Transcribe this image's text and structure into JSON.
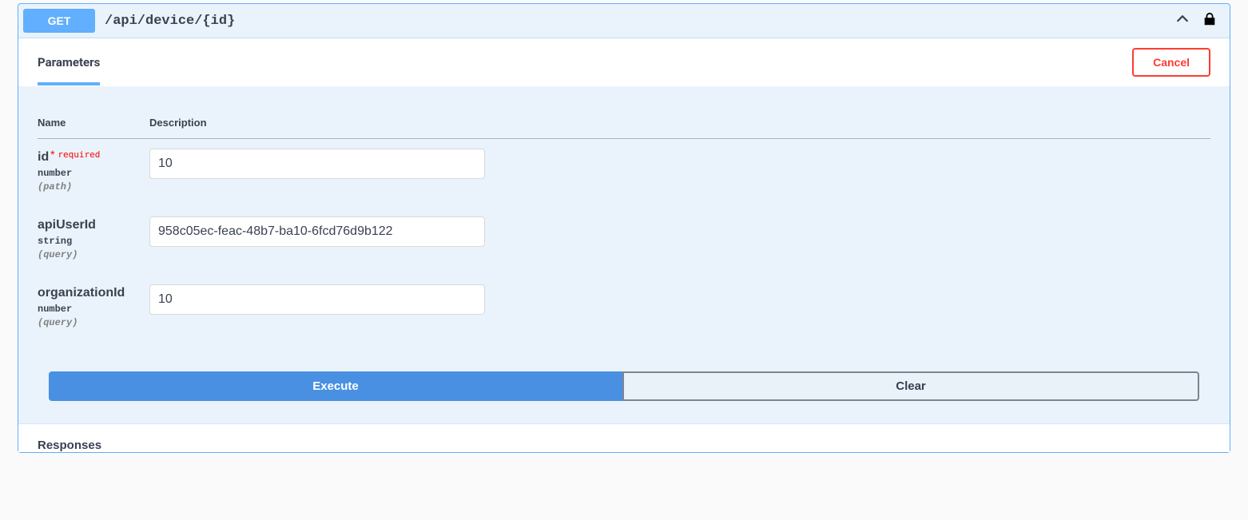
{
  "summary": {
    "method": "GET",
    "path": "/api/device/{id}"
  },
  "tabs": {
    "parameters": "Parameters"
  },
  "buttons": {
    "cancel": "Cancel",
    "execute": "Execute",
    "clear": "Clear"
  },
  "headers": {
    "name": "Name",
    "description": "Description",
    "responses": "Responses"
  },
  "labels": {
    "required": "required"
  },
  "params": [
    {
      "name": "id",
      "required": true,
      "type": "number",
      "in": "(path)",
      "value": "10"
    },
    {
      "name": "apiUserId",
      "required": false,
      "type": "string",
      "in": "(query)",
      "value": "958c05ec-feac-48b7-ba10-6fcd76d9b122"
    },
    {
      "name": "organizationId",
      "required": false,
      "type": "number",
      "in": "(query)",
      "value": "10"
    }
  ]
}
